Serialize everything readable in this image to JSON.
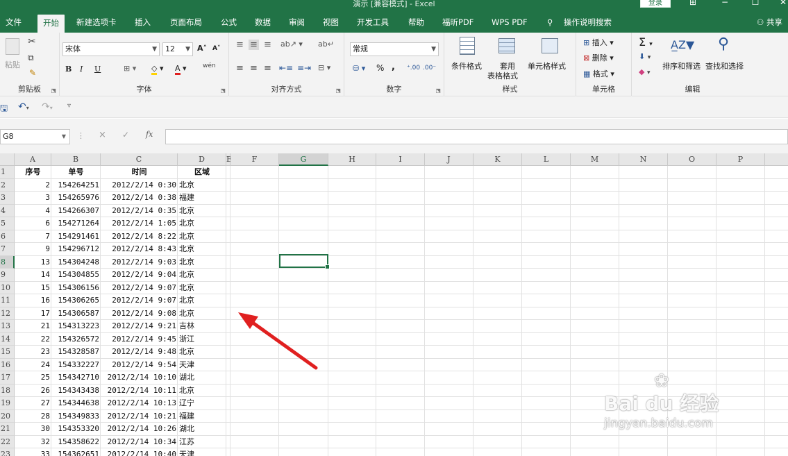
{
  "title_bar": {
    "title": "演示 [兼容模式] - Excel",
    "login_label": "登录"
  },
  "menu": {
    "tabs": [
      "文件",
      "开始",
      "新建选项卡",
      "插入",
      "页面布局",
      "公式",
      "数据",
      "审阅",
      "视图",
      "开发工具",
      "帮助",
      "福昕PDF",
      "WPS PDF",
      "操作说明搜索"
    ],
    "active_tab": "开始",
    "share_label": "共享"
  },
  "ribbon": {
    "clipboard": {
      "paste": "粘贴",
      "label": "剪贴板"
    },
    "font": {
      "name": "宋体",
      "size": "12",
      "label": "字体",
      "bold": "B",
      "italic": "I",
      "underline": "U",
      "font_color": "A",
      "phonetic": "wén"
    },
    "alignment": {
      "label": "对齐方式"
    },
    "number": {
      "format": "常规",
      "percent": "%",
      "comma": ",",
      "label": "数字"
    },
    "styles": {
      "conditional": "条件格式",
      "table_line1": "套用",
      "table_line2": "表格格式",
      "cell_styles": "单元格样式",
      "label": "样式"
    },
    "cells": {
      "insert": "插入",
      "delete": "删除",
      "format": "格式",
      "label": "单元格"
    },
    "editing": {
      "sort_filter": "排序和筛选",
      "find_select": "查找和选择",
      "label": "编辑"
    }
  },
  "formula_bar": {
    "name_box": "G8",
    "cancel": "×",
    "enter": "✓",
    "fx": "fx",
    "value": ""
  },
  "sheet": {
    "columns": [
      "A",
      "B",
      "C",
      "D",
      "E",
      "F",
      "G",
      "H",
      "I",
      "J",
      "K",
      "L",
      "M",
      "N",
      "O",
      "P"
    ],
    "selected_column": "G",
    "selected_row": "8",
    "header": [
      "序号",
      "单号",
      "时间",
      "区域"
    ],
    "rows": [
      [
        "2",
        "154264251",
        "2012/2/14 0:30",
        "北京"
      ],
      [
        "3",
        "154265976",
        "2012/2/14 0:38",
        "福建"
      ],
      [
        "4",
        "154266307",
        "2012/2/14 0:35",
        "北京"
      ],
      [
        "6",
        "154271264",
        "2012/2/14 1:05",
        "北京"
      ],
      [
        "7",
        "154291461",
        "2012/2/14 8:22",
        "北京"
      ],
      [
        "9",
        "154296712",
        "2012/2/14 8:43",
        "北京"
      ],
      [
        "13",
        "154304248",
        "2012/2/14 9:03",
        "北京"
      ],
      [
        "14",
        "154304855",
        "2012/2/14 9:04",
        "北京"
      ],
      [
        "15",
        "154306156",
        "2012/2/14 9:07",
        "北京"
      ],
      [
        "16",
        "154306265",
        "2012/2/14 9:07",
        "北京"
      ],
      [
        "17",
        "154306587",
        "2012/2/14 9:08",
        "北京"
      ],
      [
        "21",
        "154313223",
        "2012/2/14 9:21",
        "吉林"
      ],
      [
        "22",
        "154326572",
        "2012/2/14 9:45",
        "浙江"
      ],
      [
        "23",
        "154328587",
        "2012/2/14 9:48",
        "北京"
      ],
      [
        "24",
        "154332227",
        "2012/2/14 9:54",
        "天津"
      ],
      [
        "25",
        "154342710",
        "2012/2/14 10:10",
        "湖北"
      ],
      [
        "26",
        "154343438",
        "2012/2/14 10:11",
        "北京"
      ],
      [
        "27",
        "154344638",
        "2012/2/14 10:13",
        "辽宁"
      ],
      [
        "28",
        "154349833",
        "2012/2/14 10:21",
        "福建"
      ],
      [
        "30",
        "154353320",
        "2012/2/14 10:26",
        "湖北"
      ],
      [
        "32",
        "154358622",
        "2012/2/14 10:34",
        "江苏"
      ],
      [
        "33",
        "154362651",
        "2012/2/14 10:40",
        "天津"
      ]
    ]
  },
  "watermark": {
    "brand": "Bai du 经验",
    "url": "jingyan.baidu.com"
  },
  "colors": {
    "excel_green": "#217346",
    "arrow_red": "#e02020",
    "ribbon_bg": "#f3f3f3"
  }
}
